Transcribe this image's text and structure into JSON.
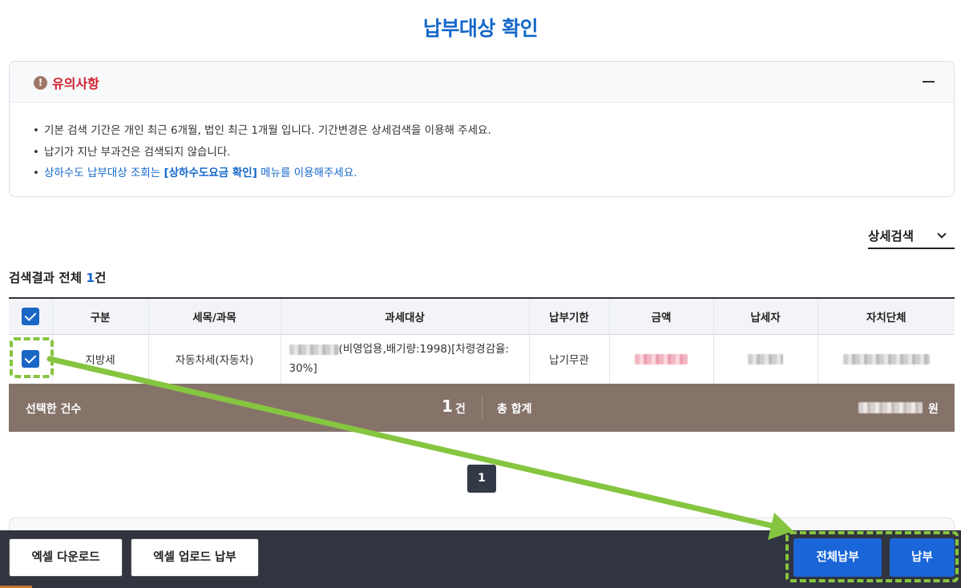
{
  "page": {
    "title": "납부대상 확인"
  },
  "notice": {
    "title": "유의사항",
    "items": [
      "기본 검색 기간은 개인 최근 6개월, 법인 최근 1개월 입니다. 기간변경은 상세검색을 이용해 주세요.",
      "납기가 지난 부과건은 검색되지 않습니다."
    ],
    "water_prefix": "상하수도 납부대상 조회는 ",
    "water_link": "[상하수도요금 확인]",
    "water_suffix": " 메뉴를 이용해주세요."
  },
  "search": {
    "detail_label": "상세검색"
  },
  "results": {
    "prefix": "검색결과 전체 ",
    "count": "1",
    "suffix": "건"
  },
  "table": {
    "headers": [
      "구분",
      "세목/과목",
      "과세대상",
      "납부기한",
      "금액",
      "납세자",
      "자치단체"
    ],
    "rows": [
      {
        "type": "지방세",
        "tax_item": "자동차세(자동차)",
        "target_text": "(비영업용,배기량:1998)[차령경감율: 30%]",
        "due": "납기무관"
      }
    ]
  },
  "summary": {
    "selected_label": "선택한 건수",
    "selected_count": "1",
    "selected_unit": "건",
    "total_label": "총 합계",
    "total_unit": "원"
  },
  "pagination": {
    "current": "1"
  },
  "footer": {
    "excel_download": "엑셀 다운로드",
    "excel_upload_pay": "엑셀 업로드 납부",
    "pay_all": "전체납부",
    "pay": "납부"
  },
  "colors": {
    "accent": "#1568c9",
    "summary_bar": "#85736a",
    "footer": "#31353f",
    "highlight": "#86c540",
    "notice_title": "#d11f2e"
  },
  "icons": {
    "notice": "warning-icon",
    "collapse": "minus-icon",
    "dropdown": "chevron-down-icon",
    "check": "checkbox-checked-icon"
  }
}
